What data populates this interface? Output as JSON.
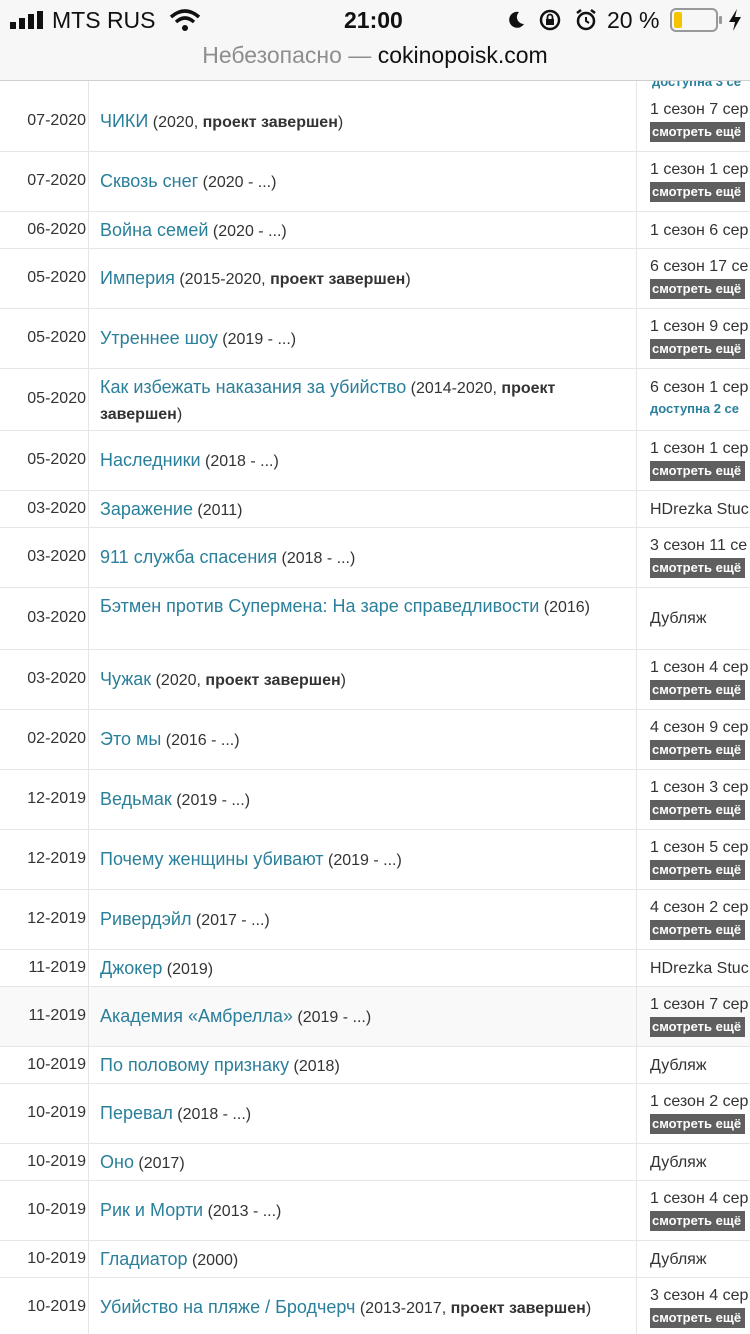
{
  "status_bar": {
    "carrier": "MTS RUS",
    "time": "21:00",
    "battery_percent": "20 %",
    "battery_level": 0.2,
    "battery_color": "#f5c400"
  },
  "url_bar": {
    "insecure_label": "Небезопасно — ",
    "host": "cokinopoisk.com"
  },
  "top_partial": {
    "info_avail": "доступна 3 се"
  },
  "colors": {
    "link": "#2a7f9a",
    "button": "#5f5f5f"
  },
  "rows": [
    {
      "date": "07-2020",
      "title": "ЧИКИ",
      "year": " (2020, ",
      "bold": "проект завершен",
      "tail": ")",
      "info": "1 сезон 7 сер",
      "more": "смотреть ещё"
    },
    {
      "date": "07-2020",
      "title": "Сквозь снег",
      "year": " (2020 - ...)",
      "bold": "",
      "tail": "",
      "info": "1 сезон 1 сер",
      "more": "смотреть ещё"
    },
    {
      "date": "06-2020",
      "title": "Война семей",
      "year": " (2020 - ...)",
      "bold": "",
      "tail": "",
      "info": "1 сезон 6 сер",
      "more": ""
    },
    {
      "date": "05-2020",
      "title": "Империя",
      "year": " (2015-2020, ",
      "bold": "проект завершен",
      "tail": ")",
      "info": "6 сезон 17 се",
      "more": "смотреть ещё"
    },
    {
      "date": "05-2020",
      "title": "Утреннее шоу",
      "year": " (2019 - ...)",
      "bold": "",
      "tail": "",
      "info": "1 сезон 9 сер",
      "more": "смотреть ещё"
    },
    {
      "date": "05-2020",
      "title": "Как избежать наказания за убийство",
      "year": " (2014-2020, ",
      "bold": "проект завершен",
      "tail": ")",
      "info": "6 сезон 1 сер",
      "more": "",
      "avail": "доступна 2 се"
    },
    {
      "date": "05-2020",
      "title": "Наследники",
      "year": " (2018 - ...)",
      "bold": "",
      "tail": "",
      "info": "1 сезон 1 сер",
      "more": "смотреть ещё"
    },
    {
      "date": "03-2020",
      "title": "Заражение",
      "year": " (2011)",
      "bold": "",
      "tail": "",
      "info": "HDrezka Stuc",
      "more": ""
    },
    {
      "date": "03-2020",
      "title": "911 служба спасения",
      "year": " (2018 - ...)",
      "bold": "",
      "tail": "",
      "info": "3 сезон 11 се",
      "more": "смотреть ещё"
    },
    {
      "date": "03-2020",
      "title": "Бэтмен против Супермена: На заре справедливости",
      "year": " (2016)",
      "bold": "",
      "tail": "",
      "info": "Дубляж",
      "more": ""
    },
    {
      "date": "03-2020",
      "title": "Чужак",
      "year": " (2020, ",
      "bold": "проект завершен",
      "tail": ")",
      "info": "1 сезон 4 сер",
      "more": "смотреть ещё"
    },
    {
      "date": "02-2020",
      "title": "Это мы",
      "year": " (2016 - ...)",
      "bold": "",
      "tail": "",
      "info": "4 сезон 9 сер",
      "more": "смотреть ещё"
    },
    {
      "date": "12-2019",
      "title": "Ведьмак",
      "year": " (2019 - ...)",
      "bold": "",
      "tail": "",
      "info": "1 сезон 3 сер",
      "more": "смотреть ещё"
    },
    {
      "date": "12-2019",
      "title": "Почему женщины убивают",
      "year": " (2019 - ...)",
      "bold": "",
      "tail": "",
      "info": "1 сезон 5 сер",
      "more": "смотреть ещё"
    },
    {
      "date": "12-2019",
      "title": "Ривердэйл",
      "year": " (2017 - ...)",
      "bold": "",
      "tail": "",
      "info": "4 сезон 2 сер",
      "more": "смотреть ещё"
    },
    {
      "date": "11-2019",
      "title": "Джокер",
      "year": " (2019)",
      "bold": "",
      "tail": "",
      "info": "HDrezka Stuc",
      "more": ""
    },
    {
      "date": "11-2019",
      "title": "Академия «Амбрелла»",
      "year": " (2019 - ...)",
      "bold": "",
      "tail": "",
      "info": "1 сезон 7 сер",
      "more": "смотреть ещё",
      "hl": true
    },
    {
      "date": "10-2019",
      "title": "По половому признаку",
      "year": " (2018)",
      "bold": "",
      "tail": "",
      "info": "Дубляж",
      "more": ""
    },
    {
      "date": "10-2019",
      "title": "Перевал",
      "year": " (2018 - ...)",
      "bold": "",
      "tail": "",
      "info": "1 сезон 2 сер",
      "more": "смотреть ещё"
    },
    {
      "date": "10-2019",
      "title": "Оно",
      "year": " (2017)",
      "bold": "",
      "tail": "",
      "info": "Дубляж",
      "more": ""
    },
    {
      "date": "10-2019",
      "title": "Рик и Морти",
      "year": " (2013 - ...)",
      "bold": "",
      "tail": "",
      "info": "1 сезон 4 сер",
      "more": "смотреть ещё"
    },
    {
      "date": "10-2019",
      "title": "Гладиатор",
      "year": " (2000)",
      "bold": "",
      "tail": "",
      "info": "Дубляж",
      "more": ""
    },
    {
      "date": "10-2019",
      "title": "Убийство на пляже / Бродчерч",
      "year": " (2013-2017, ",
      "bold": "проект завершен",
      "tail": ")",
      "info": "3 сезон 4 сер",
      "more": "смотреть ещё"
    }
  ]
}
